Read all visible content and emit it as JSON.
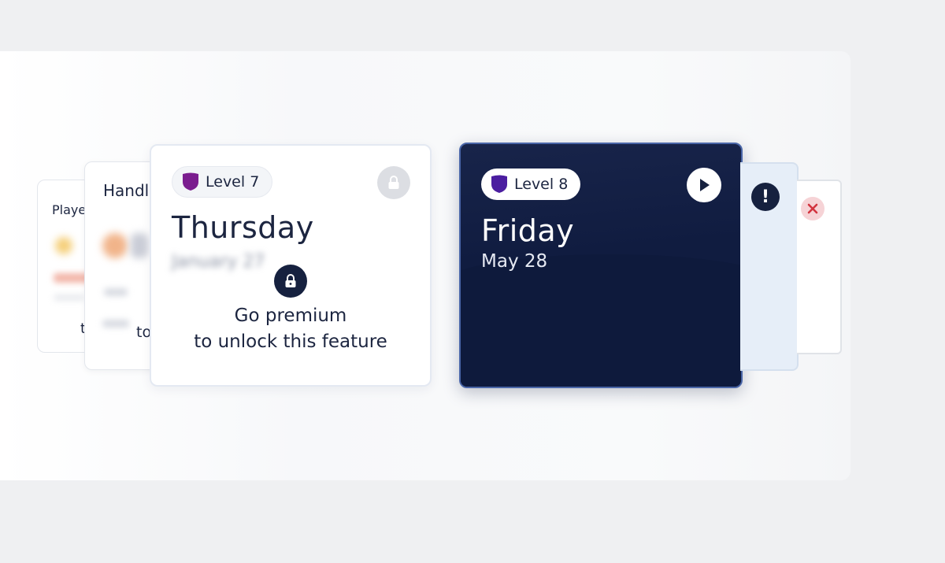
{
  "cards": {
    "players": {
      "title": "Playe",
      "trailing": "t"
    },
    "handles": {
      "title": "Handl",
      "trailing": "to"
    },
    "thursday": {
      "level": "Level 7",
      "day": "Thursday",
      "date": "January 27",
      "locked_line1": "Go premium",
      "locked_line2": "to unlock this feature"
    },
    "friday": {
      "level": "Level 8",
      "day": "Friday",
      "date": "May 28"
    }
  },
  "colors": {
    "navy": "#101c40",
    "shield_level7": "#7b1d8f",
    "shield_level8": "#4b1ea0",
    "error_red": "#d2343f"
  },
  "icons": [
    "shield-icon",
    "lock-icon",
    "play-icon",
    "alert-icon",
    "close-icon"
  ]
}
